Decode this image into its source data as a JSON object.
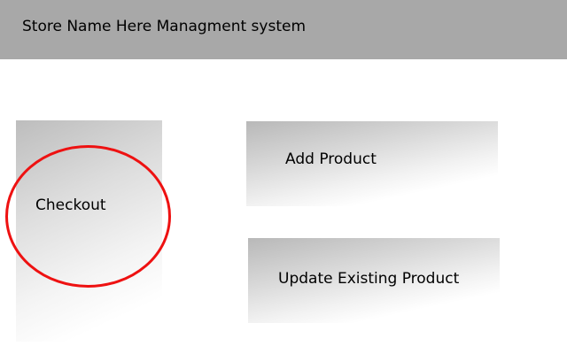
{
  "header": {
    "title": "Store Name Here Managment system"
  },
  "tiles": {
    "checkout": {
      "label": "Checkout"
    },
    "add_product": {
      "label": "Add Product"
    },
    "update_product": {
      "label": "Update Existing Product"
    }
  },
  "highlight": {
    "color": "#ee1111"
  }
}
